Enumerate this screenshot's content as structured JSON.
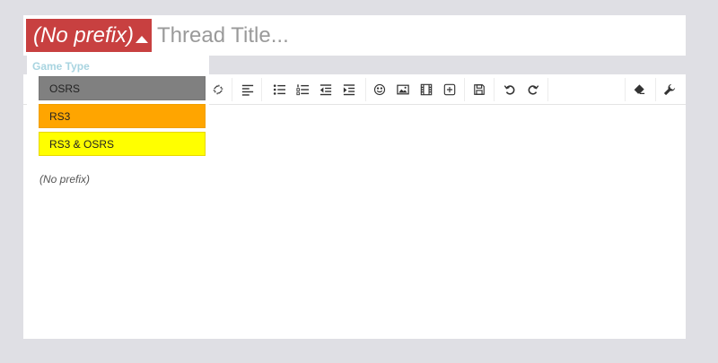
{
  "title_bar": {
    "prefix_label": "(No prefix)",
    "title_placeholder": "Thread Title..."
  },
  "prefix_dropdown": {
    "group_header": "Game Type",
    "options": [
      {
        "label": "OSRS",
        "color": "#808080"
      },
      {
        "label": "RS3",
        "color": "#FFA500"
      },
      {
        "label": "RS3 & OSRS",
        "color": "#FFFF00"
      }
    ]
  },
  "editor": {
    "toolbar_icons": [
      "unlink-icon",
      "align-left-icon",
      "bullet-list-icon",
      "numbered-list-icon",
      "outdent-icon",
      "indent-icon",
      "smiley-icon",
      "image-icon",
      "media-icon",
      "insert-icon",
      "save-draft-icon",
      "undo-icon",
      "redo-icon",
      "eraser-icon",
      "wrench-icon"
    ],
    "content_preview": "(No prefix)"
  },
  "colors": {
    "prefix_bg": "#C84040",
    "page_bg": "#DFDFE4"
  }
}
